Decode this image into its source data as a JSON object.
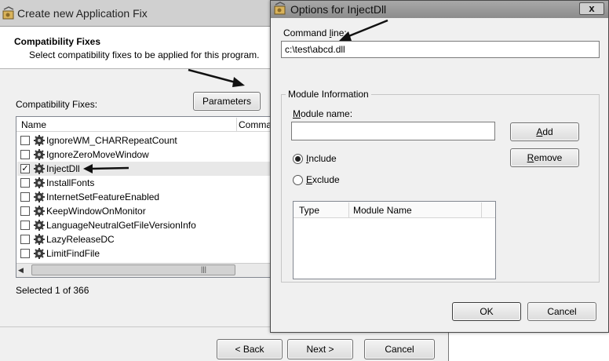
{
  "background_window": {
    "title": "Create new Application Fix",
    "heading": "Compatibility Fixes",
    "subheading": "Select compatibility fixes to be applied for this program.",
    "parameters_label": "Parameters",
    "list_label": "Compatibility Fixes:",
    "columns": [
      "Name",
      "Comma"
    ],
    "fixes": [
      {
        "name": "IgnoreWM_CHARRepeatCount",
        "checked": false
      },
      {
        "name": "IgnoreZeroMoveWindow",
        "checked": false
      },
      {
        "name": "InjectDll",
        "checked": true
      },
      {
        "name": "InstallFonts",
        "checked": false
      },
      {
        "name": "InternetSetFeatureEnabled",
        "checked": false
      },
      {
        "name": "KeepWindowOnMonitor",
        "checked": false
      },
      {
        "name": "LanguageNeutralGetFileVersionInfo",
        "checked": false
      },
      {
        "name": "LazyReleaseDC",
        "checked": false
      },
      {
        "name": "LimitFindFile",
        "checked": false
      }
    ],
    "selected_count": "Selected 1 of 366",
    "back_label": "< Back",
    "next_label": "Next >",
    "cancel_label": "Cancel"
  },
  "dialog": {
    "title": "Options for InjectDll",
    "close_label": "x",
    "command_line_label": "Command line:",
    "command_line_value": "c:\\test\\abcd.dll",
    "module_group_label": "Module Information",
    "module_name_label": "Module name:",
    "add_label": "Add",
    "remove_label": "Remove",
    "include_label": "Include",
    "exclude_label": "Exclude",
    "include_selected": true,
    "module_columns": [
      "Type",
      "Module Name"
    ],
    "ok_label": "OK",
    "cancel_label": "Cancel"
  },
  "colors": {
    "arrow": "#111111",
    "dialog_title_bg": "#9a9a9a",
    "selected_row_bg": "#e8e8e8"
  },
  "icons": [
    "app-fix-icon",
    "gear-icon",
    "close-icon",
    "arrow-annotation-icon"
  ]
}
